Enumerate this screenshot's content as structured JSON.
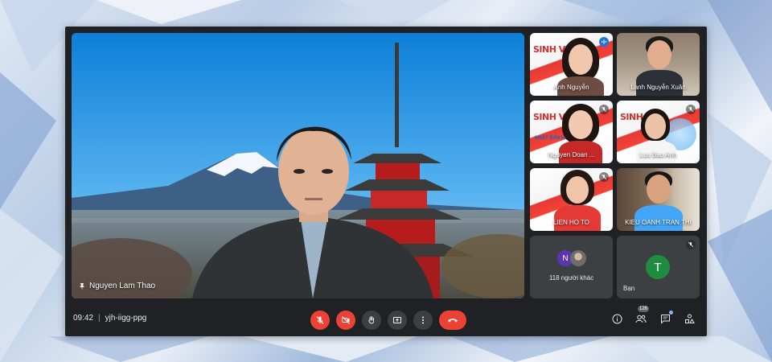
{
  "meeting": {
    "time": "09:42",
    "separator": "|",
    "code": "yjh-iigg-ppg"
  },
  "main_speaker": {
    "name": "Nguyen Lam Thao"
  },
  "participants": [
    {
      "name": "Anh Nguyễn",
      "state": "speaking"
    },
    {
      "name": "Lanh Nguyễn Xuân",
      "state": "unmuted"
    },
    {
      "name": "Nguyen Doan ...",
      "state": "muted"
    },
    {
      "name": "Luu Bao Anh",
      "state": "muted"
    },
    {
      "name": "LIEN HO TO",
      "state": "muted"
    },
    {
      "name": "KIEU OANH TRAN THI",
      "state": "unmuted"
    }
  ],
  "others_tile": {
    "avatar_letter": "N",
    "label": "118 người khác"
  },
  "self_tile": {
    "avatar_letter": "T",
    "label": "Bạn"
  },
  "banner": {
    "headline_1": "SINH VI",
    "headline_2": "SINH VIÊ",
    "sub": "NHẬT BẢN HỌC"
  },
  "participant_count": "126",
  "controls": {
    "mic": "mic-off-icon",
    "camera": "camera-off-icon",
    "hand": "raise-hand-icon",
    "present": "present-screen-icon",
    "more": "more-options-icon",
    "hangup": "hang-up-icon"
  },
  "colors": {
    "window_bg": "#202124",
    "danger": "#ea4335",
    "control_bg": "#3c4043",
    "accent": "#8ab4f8",
    "self_avatar": "#1e8e3e",
    "others_avatar": "#5e35b1"
  }
}
